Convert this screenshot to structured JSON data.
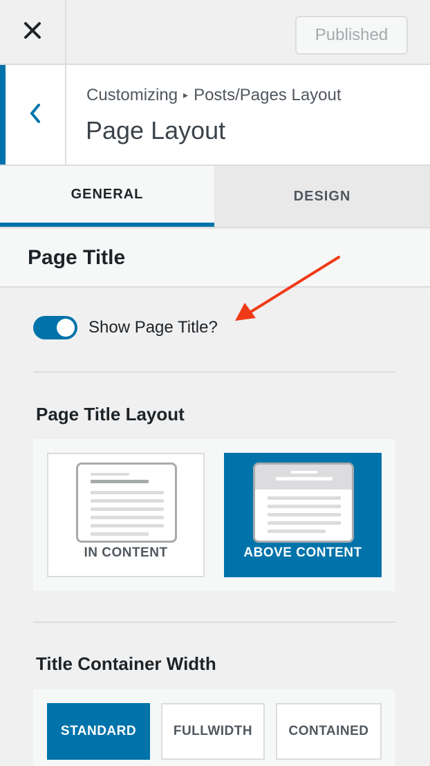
{
  "topbar": {
    "close_icon": "close-icon",
    "published_label": "Published"
  },
  "header": {
    "back_icon": "chevron-left-icon",
    "breadcrumb_root": "Customizing",
    "breadcrumb_sep": "▸",
    "breadcrumb_section": "Posts/Pages Layout",
    "title": "Page Layout",
    "accent_color": "#0073aa"
  },
  "tabs": [
    {
      "label": "GENERAL",
      "active": true
    },
    {
      "label": "DESIGN",
      "active": false
    }
  ],
  "section": {
    "title": "Page Title"
  },
  "show_title_toggle": {
    "label": "Show Page Title?",
    "on": true
  },
  "page_title_layout": {
    "label": "Page Title Layout",
    "options": [
      {
        "label": "IN CONTENT",
        "selected": false
      },
      {
        "label": "ABOVE CONTENT",
        "selected": true
      }
    ]
  },
  "title_container_width": {
    "label": "Title Container Width",
    "options": [
      {
        "label": "STANDARD",
        "selected": true
      },
      {
        "label": "FULLWIDTH",
        "selected": false
      },
      {
        "label": "CONTAINED",
        "selected": false
      }
    ]
  },
  "annotation": {
    "arrow_color": "#f03a17"
  }
}
